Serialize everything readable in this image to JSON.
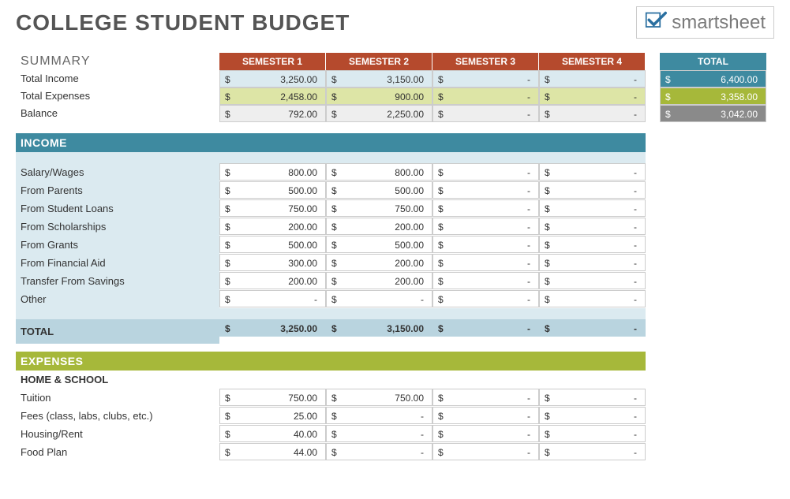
{
  "title": "COLLEGE STUDENT BUDGET",
  "brand": "smartsheet",
  "summary": {
    "heading": "SUMMARY",
    "semesters": [
      "SEMESTER 1",
      "SEMESTER 2",
      "SEMESTER 3",
      "SEMESTER 4"
    ],
    "total_header": "TOTAL",
    "rows": {
      "income": {
        "label": "Total Income",
        "vals": [
          "3,250.00",
          "3,150.00",
          "-",
          "-"
        ],
        "total": "6,400.00"
      },
      "expenses": {
        "label": "Total Expenses",
        "vals": [
          "2,458.00",
          "900.00",
          "-",
          "-"
        ],
        "total": "3,358.00"
      },
      "balance": {
        "label": "Balance",
        "vals": [
          "792.00",
          "2,250.00",
          "-",
          "-"
        ],
        "total": "3,042.00"
      }
    }
  },
  "income": {
    "heading": "INCOME",
    "rows": [
      {
        "label": "Salary/Wages",
        "vals": [
          "800.00",
          "800.00",
          "-",
          "-"
        ]
      },
      {
        "label": "From Parents",
        "vals": [
          "500.00",
          "500.00",
          "-",
          "-"
        ]
      },
      {
        "label": "From Student Loans",
        "vals": [
          "750.00",
          "750.00",
          "-",
          "-"
        ]
      },
      {
        "label": "From Scholarships",
        "vals": [
          "200.00",
          "200.00",
          "-",
          "-"
        ]
      },
      {
        "label": "From Grants",
        "vals": [
          "500.00",
          "500.00",
          "-",
          "-"
        ]
      },
      {
        "label": "From Financial Aid",
        "vals": [
          "300.00",
          "200.00",
          "-",
          "-"
        ]
      },
      {
        "label": "Transfer From Savings",
        "vals": [
          "200.00",
          "200.00",
          "-",
          "-"
        ]
      },
      {
        "label": "Other",
        "vals": [
          "-",
          "-",
          "-",
          "-"
        ]
      }
    ],
    "total": {
      "label": "TOTAL",
      "vals": [
        "3,250.00",
        "3,150.00",
        "-",
        "-"
      ]
    }
  },
  "expenses": {
    "heading": "EXPENSES",
    "groups": [
      {
        "name": "HOME & SCHOOL",
        "rows": [
          {
            "label": "Tuition",
            "vals": [
              "750.00",
              "750.00",
              "-",
              "-"
            ]
          },
          {
            "label": "Fees (class, labs, clubs, etc.)",
            "vals": [
              "25.00",
              "-",
              "-",
              "-"
            ]
          },
          {
            "label": "Housing/Rent",
            "vals": [
              "40.00",
              "-",
              "-",
              "-"
            ]
          },
          {
            "label": "Food Plan",
            "vals": [
              "44.00",
              "-",
              "-",
              "-"
            ]
          }
        ]
      }
    ]
  }
}
